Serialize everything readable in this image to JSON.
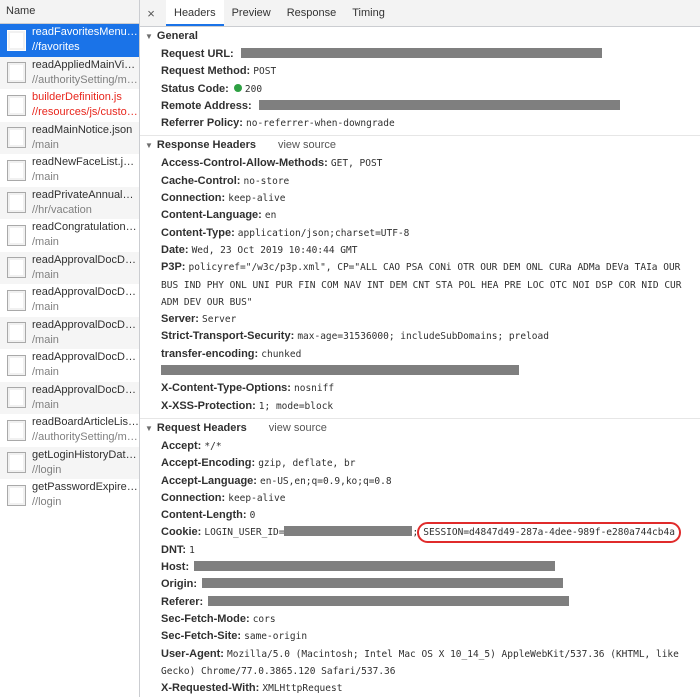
{
  "left": {
    "header": "Name",
    "requests": [
      {
        "name": "readFavoritesMenuLis...",
        "path": "//favorites",
        "state": "selected"
      },
      {
        "name": "readAppliedMainView...",
        "path": "//authoritySetting/mai...",
        "state": ""
      },
      {
        "name": "builderDefinition.js",
        "path": "//resources/js/custom...",
        "state": "error"
      },
      {
        "name": "readMainNotice.json",
        "path": "/main",
        "state": ""
      },
      {
        "name": "readNewFaceList.json",
        "path": "/main",
        "state": ""
      },
      {
        "name": "readPrivateAnnualVac...",
        "path": "//hr/vacation",
        "state": ""
      },
      {
        "name": "readCongratulationsC...",
        "path": "/main",
        "state": ""
      },
      {
        "name": "readApprovalDocData...",
        "path": "/main",
        "state": ""
      },
      {
        "name": "readApprovalDocData...",
        "path": "/main",
        "state": ""
      },
      {
        "name": "readApprovalDocData...",
        "path": "/main",
        "state": ""
      },
      {
        "name": "readApprovalDocData...",
        "path": "/main",
        "state": ""
      },
      {
        "name": "readApprovalDocData...",
        "path": "/main",
        "state": ""
      },
      {
        "name": "readBoardArticleList.j...",
        "path": "//authoritySetting/mai...",
        "state": ""
      },
      {
        "name": "getLoginHistoryData.j...",
        "path": "//login",
        "state": ""
      },
      {
        "name": "getPasswordExpireDa...",
        "path": "//login",
        "state": ""
      }
    ]
  },
  "tabs": {
    "close": "×",
    "items": [
      "Headers",
      "Preview",
      "Response",
      "Timing"
    ],
    "active": "Headers"
  },
  "general": {
    "title": "General",
    "request_url_key": "Request URL:",
    "request_method_key": "Request Method:",
    "request_method": "POST",
    "status_code_key": "Status Code:",
    "status_code": "200",
    "remote_address_key": "Remote Address:",
    "referrer_policy_key": "Referrer Policy:",
    "referrer_policy": "no-referrer-when-downgrade"
  },
  "response_headers": {
    "title": "Response Headers",
    "view_source": "view source",
    "items": [
      {
        "k": "Access-Control-Allow-Methods:",
        "v": "GET, POST"
      },
      {
        "k": "Cache-Control:",
        "v": "no-store"
      },
      {
        "k": "Connection:",
        "v": "keep-alive"
      },
      {
        "k": "Content-Language:",
        "v": "en"
      },
      {
        "k": "Content-Type:",
        "v": "application/json;charset=UTF-8"
      },
      {
        "k": "Date:",
        "v": "Wed, 23 Oct 2019 10:40:44 GMT"
      }
    ],
    "p3p_key": "P3P:",
    "p3p_value": "policyref=\"/w3c/p3p.xml\", CP=\"ALL CAO PSA CONi OTR OUR DEM ONL CURa ADMa DEVa TAIa OUR BUS IND PHY ONL UNI PUR FIN COM NAV INT DEM CNT STA POL HEA PRE LOC OTC NOI DSP COR NID CUR ADM DEV OUR BUS\"",
    "items2": [
      {
        "k": "Server:",
        "v": "Server"
      },
      {
        "k": "Strict-Transport-Security:",
        "v": "max-age=31536000; includeSubDomains; preload"
      },
      {
        "k": "transfer-encoding:",
        "v": "chunked"
      }
    ],
    "items3": [
      {
        "k": "X-Content-Type-Options:",
        "v": "nosniff"
      },
      {
        "k": "X-XSS-Protection:",
        "v": "1; mode=block"
      }
    ]
  },
  "request_headers": {
    "title": "Request Headers",
    "view_source": "view source",
    "items": [
      {
        "k": "Accept:",
        "v": "*/*"
      },
      {
        "k": "Accept-Encoding:",
        "v": "gzip, deflate, br"
      },
      {
        "k": "Accept-Language:",
        "v": "en-US,en;q=0.9,ko;q=0.8"
      },
      {
        "k": "Connection:",
        "v": "keep-alive"
      },
      {
        "k": "Content-Length:",
        "v": "0"
      }
    ],
    "cookie_key": "Cookie:",
    "cookie_prefix": "LOGIN_USER_ID=",
    "cookie_sep": ";",
    "cookie_session": "SESSION=d4847d49-287a-4dee-989f-e280a744cb4a",
    "dnt_key": "DNT:",
    "dnt": "1",
    "host_key": "Host:",
    "origin_key": "Origin:",
    "referer_key": "Referer:",
    "items2": [
      {
        "k": "Sec-Fetch-Mode:",
        "v": "cors"
      },
      {
        "k": "Sec-Fetch-Site:",
        "v": "same-origin"
      }
    ],
    "ua_key": "User-Agent:",
    "ua_value": "Mozilla/5.0 (Macintosh; Intel Mac OS X 10_14_5) AppleWebKit/537.36 (KHTML, like Gecko) Chrome/77.0.3865.120 Safari/537.36",
    "xrw_key": "X-Requested-With:",
    "xrw": "XMLHttpRequest"
  },
  "colors": {
    "accent": "#1a73e8",
    "error": "#e8261d",
    "status_ok": "#2ea043",
    "highlight": "#e02b2b"
  }
}
